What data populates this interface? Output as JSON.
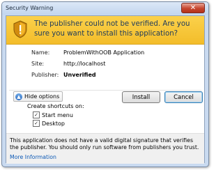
{
  "window": {
    "title": "Security Warning",
    "close_glyph": "✕"
  },
  "banner": {
    "icon": "shield-warning-icon",
    "headline": "The publisher could not be verified. Are you sure you want to install this application?"
  },
  "details": {
    "name_label": "Name:",
    "name_value": "ProblemWithOOB Application",
    "site_label": "Site:",
    "site_value": "http://localhost",
    "publisher_label": "Publisher:",
    "publisher_value": "Unverified"
  },
  "options": {
    "toggle_label": "Hide options",
    "toggle_glyph": "▲",
    "shortcuts_label": "Create shortcuts on:",
    "start_menu_label": "Start menu",
    "start_menu_checked": true,
    "desktop_label": "Desktop",
    "desktop_checked": true,
    "check_glyph": "✓"
  },
  "buttons": {
    "install": "Install",
    "cancel": "Cancel"
  },
  "footer": {
    "text": "This application does not have a valid digital signature that verifies the publisher. You should only run software from publishers you trust.",
    "link": "More Information"
  },
  "colors": {
    "banner": "#f7c636",
    "headline": "#1e3a5c",
    "link": "#0b58b5"
  }
}
